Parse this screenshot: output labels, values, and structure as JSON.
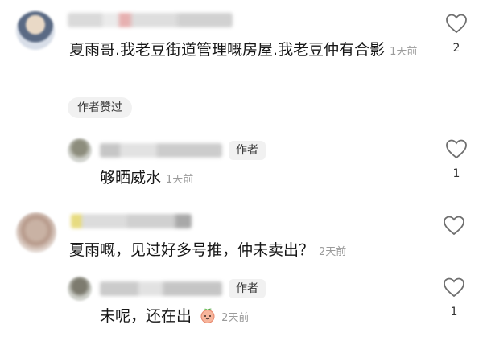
{
  "comments": [
    {
      "text": "夏雨哥.我老豆街道管理嘅房屋.我老豆仲有合影",
      "time": "1天前",
      "author_liked_label": "作者赞过",
      "likes": "2",
      "reply": {
        "author_badge": "作者",
        "text": "够晒威水",
        "time": "1天前",
        "likes": "1"
      }
    },
    {
      "text": "夏雨嘅，见过好多号推，仲未卖出？",
      "time": "2天前",
      "likes": "",
      "reply": {
        "author_badge": "作者",
        "text": "未呢，还在出",
        "time": "2天前",
        "likes": "1"
      }
    }
  ],
  "colors": {
    "text": "#161616",
    "meta": "#9b9b9b",
    "badge_bg": "#f1f1f1"
  }
}
